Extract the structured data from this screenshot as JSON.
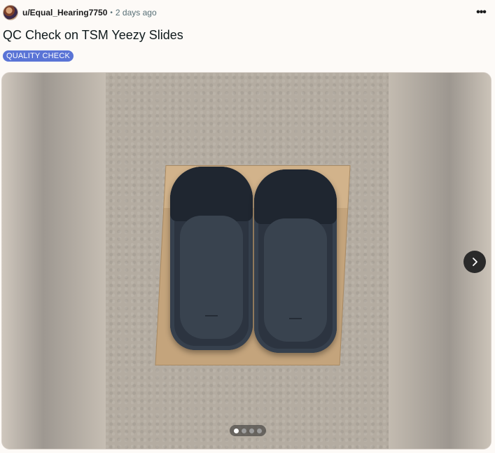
{
  "post": {
    "username": "u/Equal_Hearing7750",
    "separator": "•",
    "time": "2 days ago",
    "more_label": "•••",
    "title": "QC Check on TSM Yeezy Slides",
    "flair": "QUALITY CHECK"
  },
  "gallery": {
    "image_count": 4,
    "active_index": 0,
    "next_icon": "chevron-right-icon"
  },
  "colors": {
    "flair_bg": "#5a74d6",
    "page_bg": "#fdfaf7"
  }
}
